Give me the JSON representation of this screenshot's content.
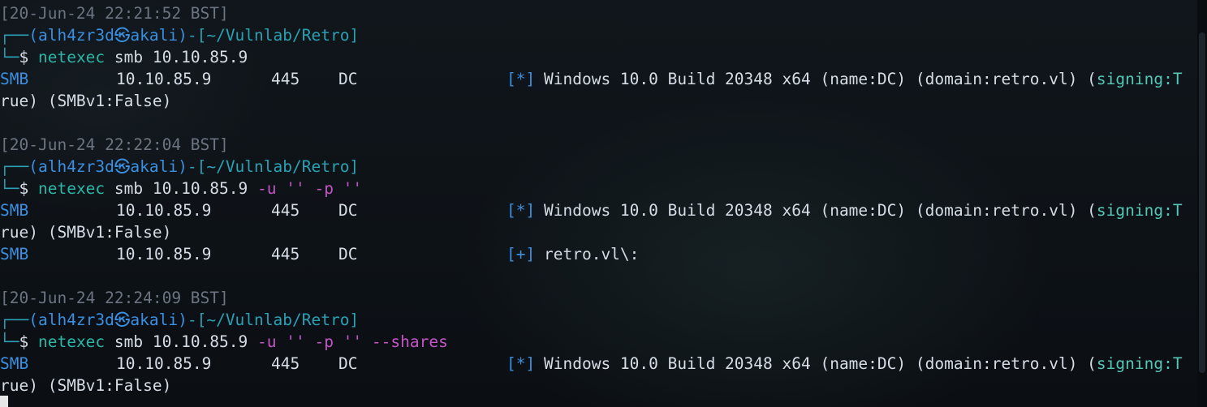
{
  "blocks": [
    {
      "timestamp": "[20-Jun-24 22:21:52 BST]",
      "user": "(alh4zr3d㉿akali)",
      "path": "[~/Vulnlab/Retro]",
      "prompt": "$",
      "cmd": "netexec",
      "args": " smb 10.10.85.9",
      "flags": "",
      "rows": [
        {
          "proto": "SMB",
          "ip": "10.10.85.9",
          "port": "445",
          "host": "DC",
          "marker": "[*]",
          "msg": "Windows 10.0 Build 20348 x64 (name:DC) (domain:retro.vl) (",
          "sign": "signing:T",
          "wrap": "rue) (SMBv1:False)"
        }
      ]
    },
    {
      "timestamp": "[20-Jun-24 22:22:04 BST]",
      "user": "(alh4zr3d㉿akali)",
      "path": "[~/Vulnlab/Retro]",
      "prompt": "$",
      "cmd": "netexec",
      "args": " smb 10.10.85.9 ",
      "flags": "-u '' -p ''",
      "rows": [
        {
          "proto": "SMB",
          "ip": "10.10.85.9",
          "port": "445",
          "host": "DC",
          "marker": "[*]",
          "msg": "Windows 10.0 Build 20348 x64 (name:DC) (domain:retro.vl) (",
          "sign": "signing:T",
          "wrap": "rue) (SMBv1:False)"
        },
        {
          "proto": "SMB",
          "ip": "10.10.85.9",
          "port": "445",
          "host": "DC",
          "marker": "[+]",
          "msg": "retro.vl\\:",
          "sign": "",
          "wrap": ""
        }
      ]
    },
    {
      "timestamp": "[20-Jun-24 22:24:09 BST]",
      "user": "(alh4zr3d㉿akali)",
      "path": "[~/Vulnlab/Retro]",
      "prompt": "$",
      "cmd": "netexec",
      "args": " smb 10.10.85.9 ",
      "flags": "-u '' -p '' --shares",
      "rows": [
        {
          "proto": "SMB",
          "ip": "10.10.85.9",
          "port": "445",
          "host": "DC",
          "marker": "[*]",
          "msg": "Windows 10.0 Build 20348 x64 (name:DC) (domain:retro.vl) (",
          "sign": "signing:T",
          "wrap": "rue) (SMBv1:False)"
        }
      ]
    }
  ],
  "frame": {
    "top": "┌──",
    "bottom": "└─",
    "dash": "-"
  }
}
